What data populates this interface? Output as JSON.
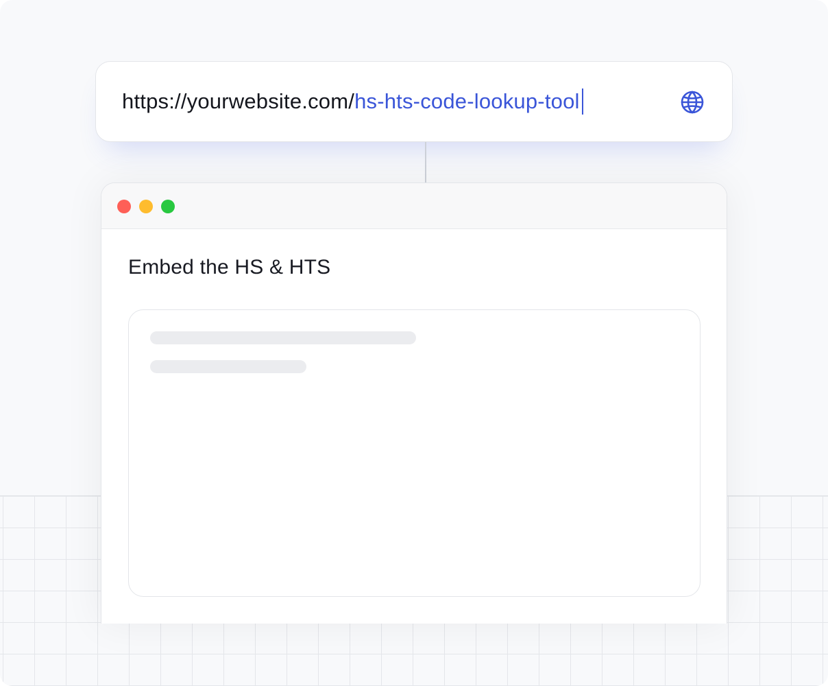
{
  "address_bar": {
    "url_base": "https://yourwebsite.com/",
    "url_slug": "hs-hts-code-lookup-tool",
    "icon": "globe-icon",
    "accent_color": "#3a55d8"
  },
  "browser_window": {
    "controls": {
      "close_color": "#fe5f57",
      "minimize_color": "#febc2e",
      "maximize_color": "#28c840"
    },
    "page": {
      "heading": "Embed the HS & HTS"
    }
  }
}
